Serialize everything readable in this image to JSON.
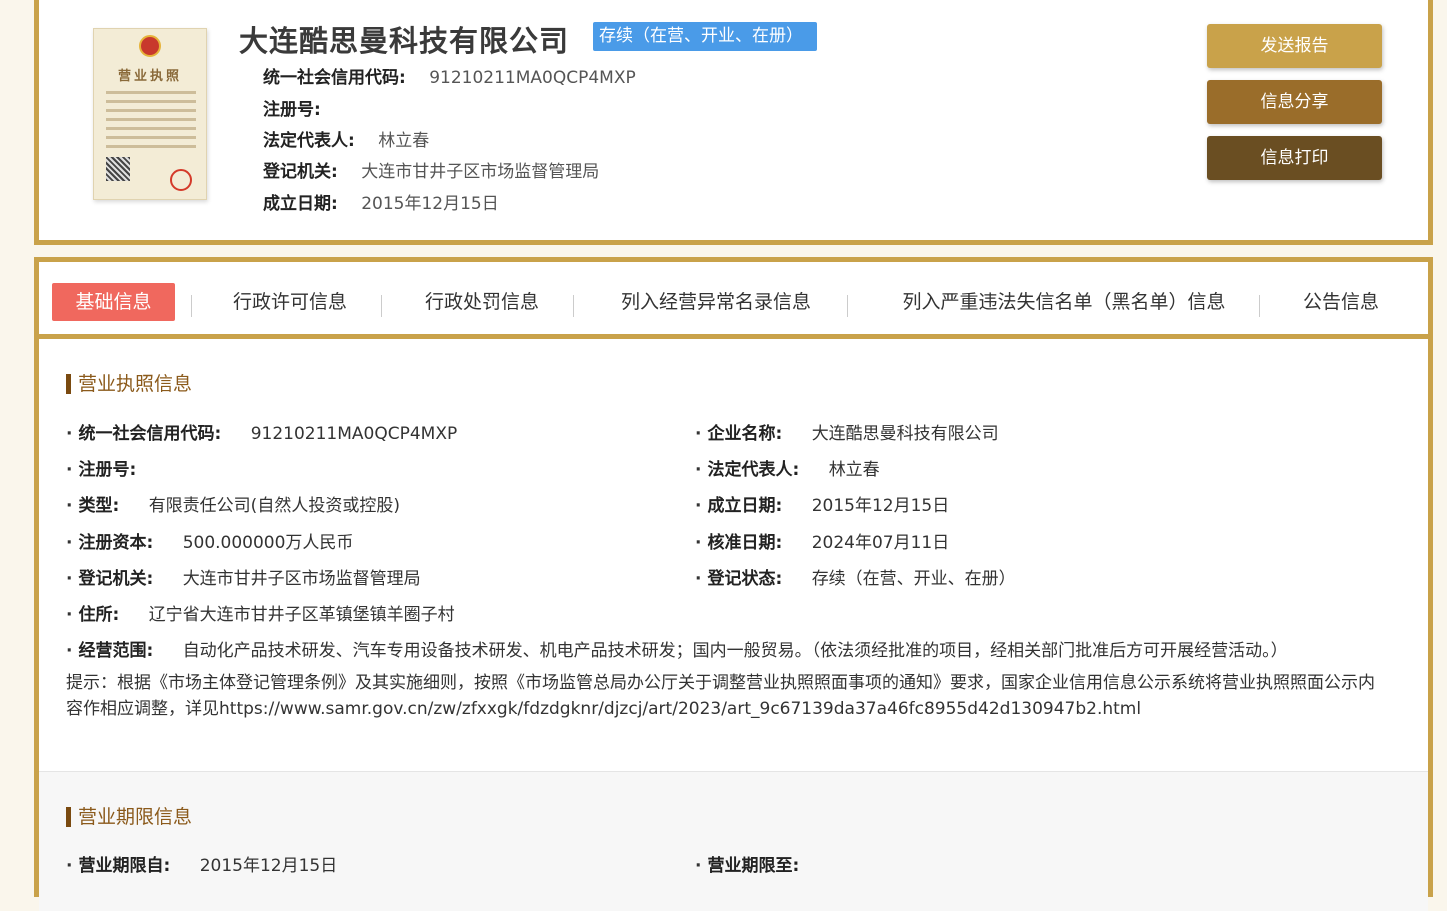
{
  "header": {
    "company_name": "大连酷思曼科技有限公司",
    "status_tag": "存续（在营、开业、在册）",
    "rows": [
      {
        "label": "统一社会信用代码:",
        "value": "91210211MA0QCP4MXP"
      },
      {
        "label": "注册号:",
        "value": ""
      },
      {
        "label": "法定代表人:",
        "value": "林立春"
      },
      {
        "label": "登记机关:",
        "value": "大连市甘井子区市场监督管理局"
      },
      {
        "label": "成立日期:",
        "value": "2015年12月15日"
      }
    ],
    "license_thumb_title": "营业执照",
    "buttons": {
      "send": "发送报告",
      "share": "信息分享",
      "print": "信息打印"
    }
  },
  "tabs": [
    {
      "label": "基础信息",
      "active": true
    },
    {
      "label": "行政许可信息",
      "active": false
    },
    {
      "label": "行政处罚信息",
      "active": false
    },
    {
      "label": "列入经营异常名录信息",
      "active": false
    },
    {
      "label": "列入严重违法失信名单（黑名单）信息",
      "active": false
    },
    {
      "label": "公告信息",
      "active": false
    }
  ],
  "license_section": {
    "title": "营业执照信息",
    "left": [
      {
        "label": "统一社会信用代码:",
        "value": "91210211MA0QCP4MXP"
      },
      {
        "label": "注册号:",
        "value": ""
      },
      {
        "label": "类型:",
        "value": "有限责任公司(自然人投资或控股)"
      },
      {
        "label": "注册资本:",
        "value": "500.000000万人民币"
      },
      {
        "label": "登记机关:",
        "value": "大连市甘井子区市场监督管理局"
      },
      {
        "label": "住所:",
        "value": "辽宁省大连市甘井子区革镇堡镇羊圈子村"
      },
      {
        "label": "经营范围:",
        "value": "自动化产品技术研发、汽车专用设备技术研发、机电产品技术研发；国内一般贸易。（依法须经批准的项目，经相关部门批准后方可开展经营活动。）"
      }
    ],
    "right": [
      {
        "label": "企业名称:",
        "value": "大连酷思曼科技有限公司"
      },
      {
        "label": "法定代表人:",
        "value": "林立春"
      },
      {
        "label": "成立日期:",
        "value": "2015年12月15日"
      },
      {
        "label": "核准日期:",
        "value": "2024年07月11日"
      },
      {
        "label": "登记状态:",
        "value": "存续（在营、开业、在册）"
      }
    ],
    "notice": "提示：根据《市场主体登记管理条例》及其实施细则，按照《市场监管总局办公厅关于调整营业执照照面事项的通知》要求，国家企业信用信息公示系统将营业执照照面公示内容作相应调整，详见https://www.samr.gov.cn/zw/zfxxgk/fdzdgknr/djzcj/art/2023/art_9c67139da37a46fc8955d42d130947b2.html"
  },
  "term_section": {
    "title": "营业期限信息",
    "left": {
      "label": "营业期限自:",
      "value": "2015年12月15日"
    },
    "right": {
      "label": "营业期限至:",
      "value": ""
    }
  },
  "colors": {
    "gold_border": "#c9a24a",
    "active_tab": "#f0685e",
    "status_tag": "#4a9be8"
  }
}
